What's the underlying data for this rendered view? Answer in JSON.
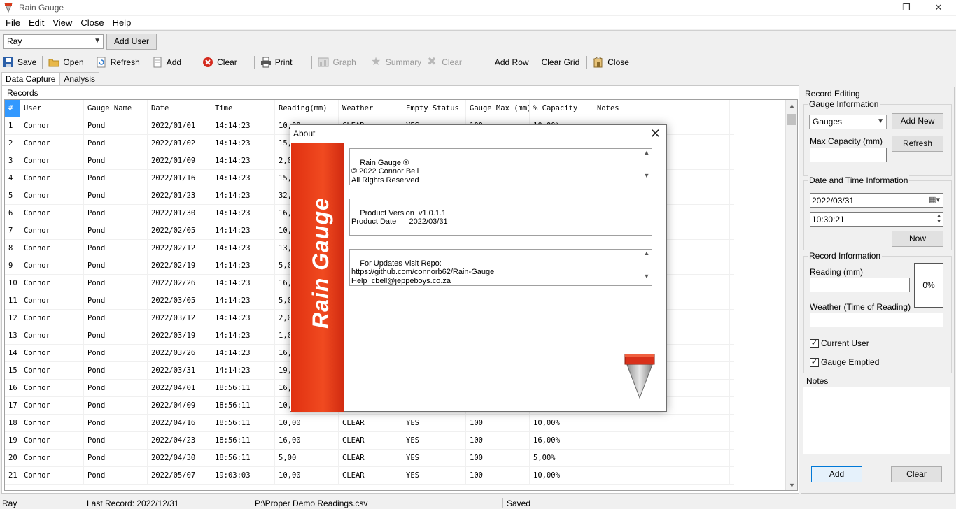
{
  "window": {
    "title": "Rain Gauge",
    "minimize": "—",
    "restore": "❐",
    "close": "✕"
  },
  "menu": [
    "File",
    "Edit",
    "View",
    "Close",
    "Help"
  ],
  "userbar": {
    "selected_user": "Ray",
    "add_user_label": "Add User"
  },
  "toolbar": {
    "save": "Save",
    "open": "Open",
    "refresh": "Refresh",
    "add": "Add",
    "clear": "Clear",
    "print": "Print",
    "graph": "Graph",
    "summary": "Summary",
    "clear2": "Clear",
    "add_row": "Add Row",
    "clear_grid": "Clear Grid",
    "close": "Close"
  },
  "tabs": [
    "Data Capture",
    "Analysis"
  ],
  "records": {
    "group_label": "Records",
    "columns": [
      "#",
      "User",
      "Gauge Name",
      "Date",
      "Time",
      "Reading(mm)",
      "Weather",
      "Empty Status",
      "Gauge Max (mm)",
      "% Capacity",
      "Notes"
    ],
    "rows": [
      [
        "1",
        "Connor",
        "Pond",
        "2022/01/01",
        "14:14:23",
        "10,00",
        "CLEAR",
        "YES",
        "100",
        "10,00%",
        ""
      ],
      [
        "2",
        "Connor",
        "Pond",
        "2022/01/02",
        "14:14:23",
        "15,",
        "",
        "",
        "",
        "",
        ""
      ],
      [
        "3",
        "Connor",
        "Pond",
        "2022/01/09",
        "14:14:23",
        "2,0",
        "",
        "",
        "",
        "",
        ""
      ],
      [
        "4",
        "Connor",
        "Pond",
        "2022/01/16",
        "14:14:23",
        "15,",
        "",
        "",
        "",
        "",
        ""
      ],
      [
        "5",
        "Connor",
        "Pond",
        "2022/01/23",
        "14:14:23",
        "32,",
        "",
        "",
        "",
        "",
        ""
      ],
      [
        "6",
        "Connor",
        "Pond",
        "2022/01/30",
        "14:14:23",
        "16,",
        "",
        "",
        "",
        "",
        ""
      ],
      [
        "7",
        "Connor",
        "Pond",
        "2022/02/05",
        "14:14:23",
        "10,",
        "",
        "",
        "",
        "",
        ""
      ],
      [
        "8",
        "Connor",
        "Pond",
        "2022/02/12",
        "14:14:23",
        "13,",
        "",
        "",
        "",
        "",
        ""
      ],
      [
        "9",
        "Connor",
        "Pond",
        "2022/02/19",
        "14:14:23",
        "5,0",
        "",
        "",
        "",
        "",
        ""
      ],
      [
        "10",
        "Connor",
        "Pond",
        "2022/02/26",
        "14:14:23",
        "16,",
        "",
        "",
        "",
        "",
        ""
      ],
      [
        "11",
        "Connor",
        "Pond",
        "2022/03/05",
        "14:14:23",
        "5,0",
        "",
        "",
        "",
        "",
        ""
      ],
      [
        "12",
        "Connor",
        "Pond",
        "2022/03/12",
        "14:14:23",
        "2,0",
        "",
        "",
        "",
        "",
        ""
      ],
      [
        "13",
        "Connor",
        "Pond",
        "2022/03/19",
        "14:14:23",
        "1,0",
        "",
        "",
        "",
        "",
        ""
      ],
      [
        "14",
        "Connor",
        "Pond",
        "2022/03/26",
        "14:14:23",
        "16,",
        "",
        "",
        "",
        "",
        ""
      ],
      [
        "15",
        "Connor",
        "Pond",
        "2022/03/31",
        "14:14:23",
        "19,",
        "",
        "",
        "",
        "",
        ""
      ],
      [
        "16",
        "Connor",
        "Pond",
        "2022/04/01",
        "18:56:11",
        "16,",
        "",
        "",
        "",
        "",
        ""
      ],
      [
        "17",
        "Connor",
        "Pond",
        "2022/04/09",
        "18:56:11",
        "10,",
        "",
        "",
        "",
        "",
        ""
      ],
      [
        "18",
        "Connor",
        "Pond",
        "2022/04/16",
        "18:56:11",
        "10,00",
        "CLEAR",
        "YES",
        "100",
        "10,00%",
        ""
      ],
      [
        "19",
        "Connor",
        "Pond",
        "2022/04/23",
        "18:56:11",
        "16,00",
        "CLEAR",
        "YES",
        "100",
        "16,00%",
        ""
      ],
      [
        "20",
        "Connor",
        "Pond",
        "2022/04/30",
        "18:56:11",
        "5,00",
        "CLEAR",
        "YES",
        "100",
        "5,00%",
        ""
      ],
      [
        "21",
        "Connor",
        "Pond",
        "2022/05/07",
        "19:03:03",
        "10,00",
        "CLEAR",
        "YES",
        "100",
        "10,00%",
        ""
      ]
    ]
  },
  "record_editing": {
    "group_label": "Record Editing",
    "gauge_info": {
      "label": "Gauge Information",
      "gauge_select": "Gauges",
      "add_new": "Add New",
      "max_capacity_label": "Max Capacity (mm)",
      "max_capacity_value": "",
      "refresh": "Refresh"
    },
    "datetime": {
      "label": "Date and Time Information",
      "date": "2022/03/31",
      "time": "10:30:21",
      "now": "Now"
    },
    "record_info": {
      "label": "Record Information",
      "reading_label": "Reading (mm)",
      "reading_value": "",
      "percent": "0%",
      "weather_label": "Weather (Time of Reading)",
      "weather_value": "",
      "current_user": "Current User",
      "gauge_emptied": "Gauge Emptied"
    },
    "notes": {
      "label": "Notes",
      "value": ""
    },
    "add": "Add",
    "clear": "Clear"
  },
  "status": {
    "user": "Ray",
    "last_record": "Last Record: 2022/12/31",
    "file": "P:\\Proper Demo Readings.csv",
    "state": "Saved"
  },
  "about": {
    "title": "About",
    "banner": "Rain Gauge",
    "box1": "Rain Gauge ®\n© 2022 Connor Bell\nAll Rights Reserved",
    "box2": "Product Version  v1.0.1.1\nProduct Date      2022/03/31",
    "box3": "For Updates Visit Repo:\nhttps://github.com/connorb62/Rain-Gauge\nHelp  cbell@jeppeboys.co.za"
  },
  "colors": {
    "accent": "#3399ff",
    "banner": "#e8401a"
  }
}
